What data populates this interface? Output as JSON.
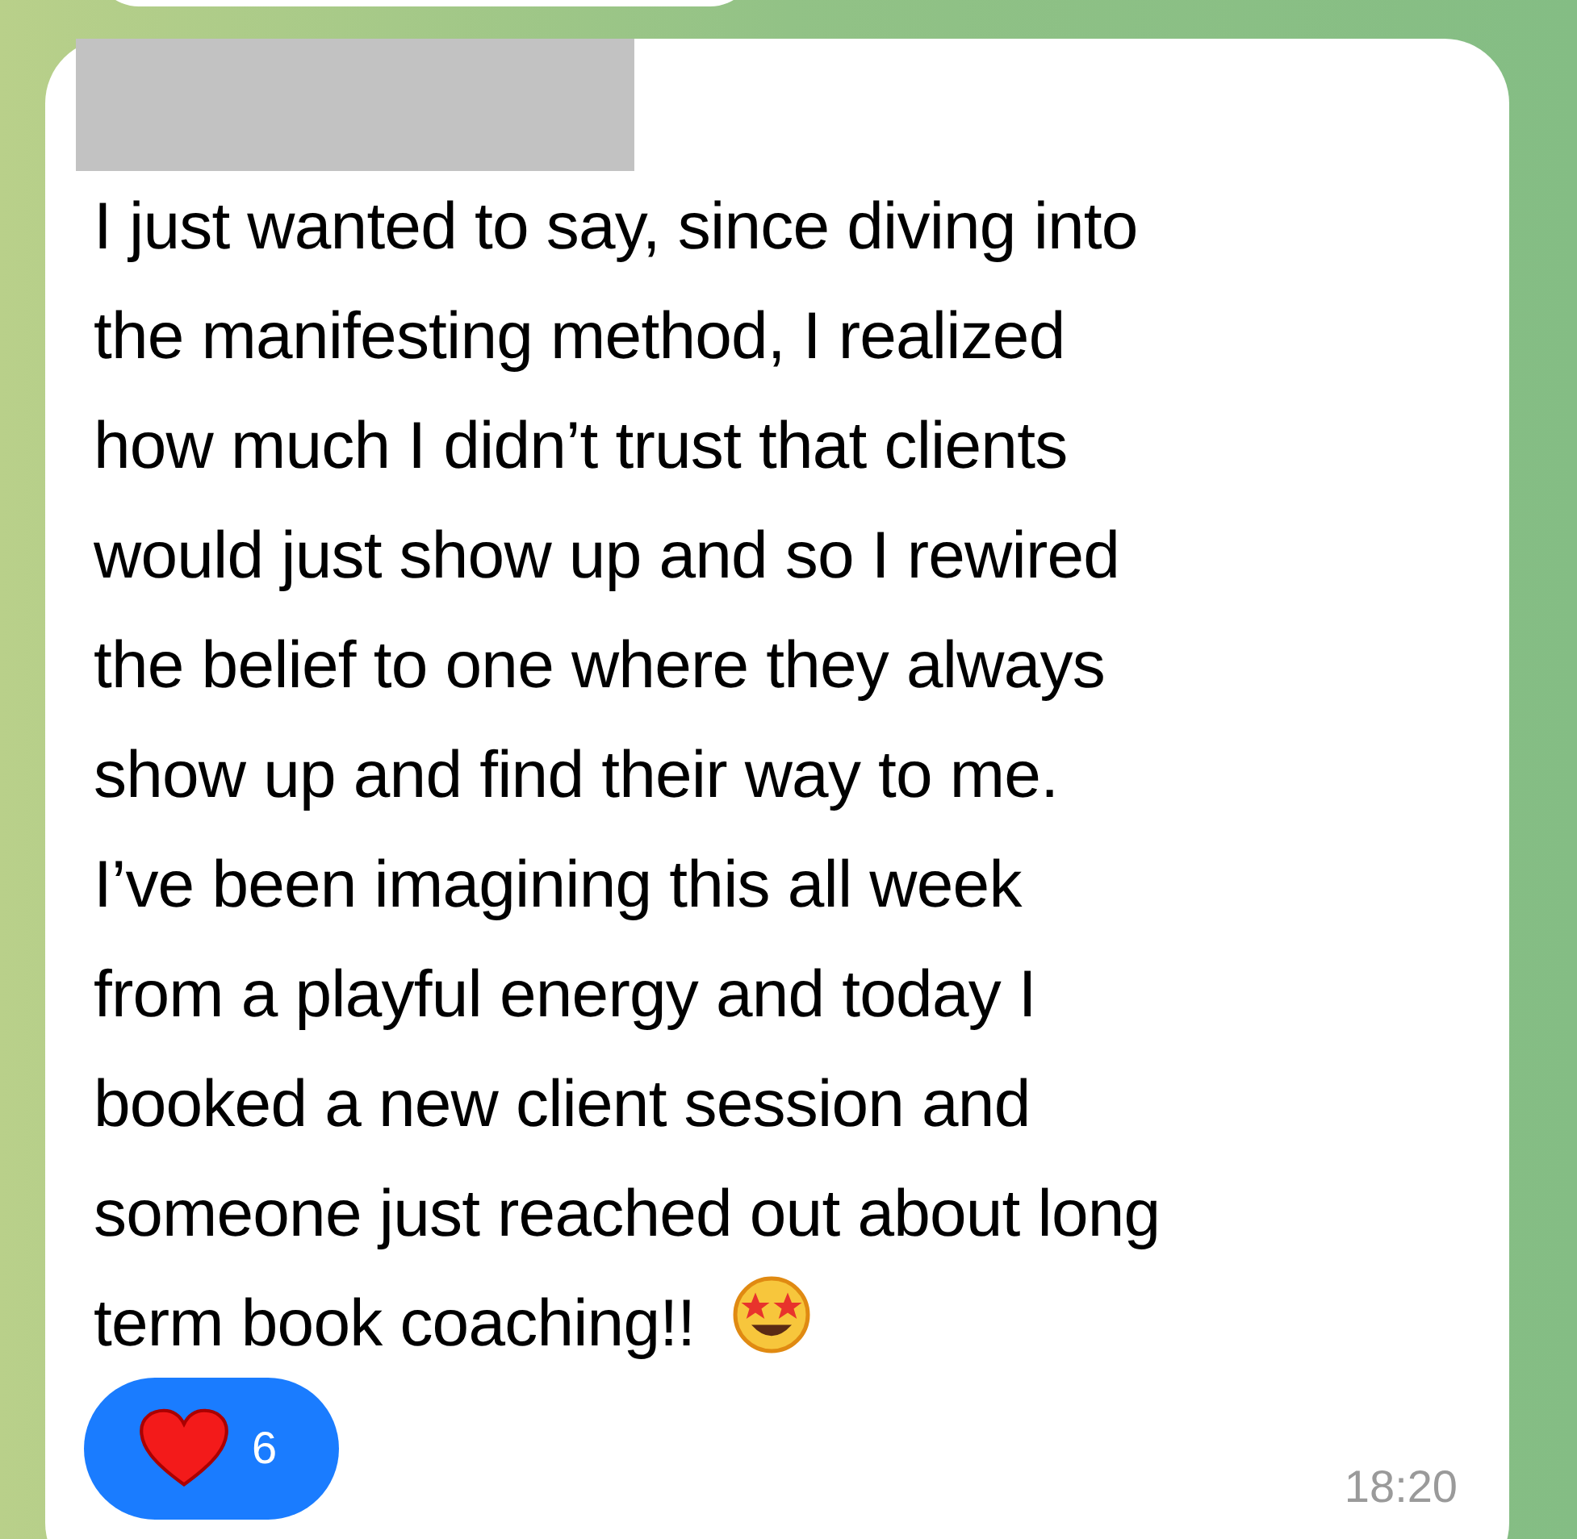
{
  "message": {
    "lines": [
      "I just wanted to say, since diving into",
      "the manifesting method, I realized",
      "how much I didn’t trust that clients",
      "would just show up and so I rewired",
      "the belief to one where they always",
      "show up and find their way to me.",
      "I’ve been imagining this all week",
      "from a playful energy and today I",
      "booked a new client session and",
      "someone just reached out about long",
      "term book coaching!!"
    ]
  },
  "reaction": {
    "count": "6",
    "selected": true
  },
  "time": "18:20"
}
